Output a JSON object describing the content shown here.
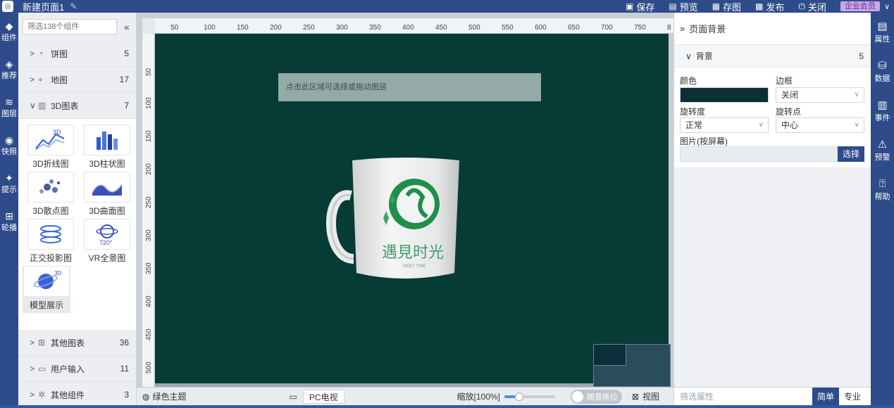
{
  "app": {
    "page_title": "新建页面1",
    "actions": [
      {
        "icon": "save-icon",
        "glyph": "▣",
        "label": "保存"
      },
      {
        "icon": "preview-icon",
        "glyph": "▤",
        "label": "预览"
      },
      {
        "icon": "image-icon",
        "glyph": "▦",
        "label": "存图"
      },
      {
        "icon": "publish-icon",
        "glyph": "▩",
        "label": "发布"
      },
      {
        "icon": "power-icon",
        "glyph": "⏻",
        "label": "关闭"
      }
    ],
    "vip_label": "企业会员"
  },
  "left_nav": [
    {
      "label": "组件",
      "glyph": "◆"
    },
    {
      "label": "推荐",
      "glyph": "◈"
    },
    {
      "label": "图层",
      "glyph": "≋"
    },
    {
      "label": "快照",
      "glyph": "◉"
    },
    {
      "label": "提示",
      "glyph": "✦"
    },
    {
      "label": "轮播",
      "glyph": "⊞"
    }
  ],
  "components": {
    "search_placeholder": "筛选138个组件",
    "collapse_glyph": "«",
    "categories_top": [
      {
        "label": "饼图",
        "count": "5",
        "arrow": ">",
        "glyph": "◔"
      },
      {
        "label": "地图",
        "count": "17",
        "arrow": ">",
        "glyph": "⌖"
      },
      {
        "label": "3D图表",
        "count": "7",
        "arrow": "∨",
        "glyph": "▥"
      }
    ],
    "tiles": [
      {
        "label": "3D折线图"
      },
      {
        "label": "3D柱状图"
      },
      {
        "label": "3D散点图"
      },
      {
        "label": "3D曲面图"
      },
      {
        "label": "正交投影图"
      },
      {
        "label": "VR全景图"
      },
      {
        "label": "模型展示"
      }
    ],
    "categories_bottom": [
      {
        "label": "其他图表",
        "count": "36",
        "arrow": ">",
        "glyph": "⊞"
      },
      {
        "label": "用户输入",
        "count": "11",
        "arrow": ">",
        "glyph": "▭"
      },
      {
        "label": "其他组件",
        "count": "3",
        "arrow": ">",
        "glyph": "✲"
      }
    ]
  },
  "ruler": {
    "h_labels": [
      "50",
      "100",
      "150",
      "200",
      "250",
      "300",
      "350",
      "400",
      "450",
      "500",
      "550",
      "600",
      "650",
      "700",
      "750",
      "8"
    ],
    "v_labels": [
      "50",
      "100",
      "150",
      "200",
      "250",
      "300",
      "350",
      "400",
      "450",
      "500"
    ]
  },
  "canvas": {
    "hint_text": "点击此区域可选择或拖动图层",
    "bg_color": "#073b36",
    "mug_brand": "遇見时光",
    "mug_sub": "MEET TIME"
  },
  "bottom": {
    "theme": "绿色主题",
    "device": "PC电视",
    "zoom": "缩放[100%]",
    "zoom_fraction": 0.3,
    "drag": "随意拖拉",
    "view": "视图"
  },
  "props": {
    "header": "页面背景",
    "section": "背景",
    "section_count": "5",
    "color_label": "颜色",
    "color_value": "#0b2f33",
    "border_label": "边框",
    "border_value": "关闭",
    "rotate_label": "旋转度",
    "rotate_value": "正常",
    "pivot_label": "旋转点",
    "pivot_value": "中心",
    "image_label": "图片(按屏幕)",
    "choose": "选择",
    "filter_placeholder": "筛选属性",
    "mode_simple": "简单",
    "mode_pro": "专业"
  },
  "right_nav": [
    {
      "label": "属性",
      "glyph": "▤"
    },
    {
      "label": "数据",
      "glyph": "⛁"
    },
    {
      "label": "事件",
      "glyph": "▥"
    },
    {
      "label": "预警",
      "glyph": "⚠"
    },
    {
      "label": "帮助",
      "glyph": "⍰"
    }
  ]
}
